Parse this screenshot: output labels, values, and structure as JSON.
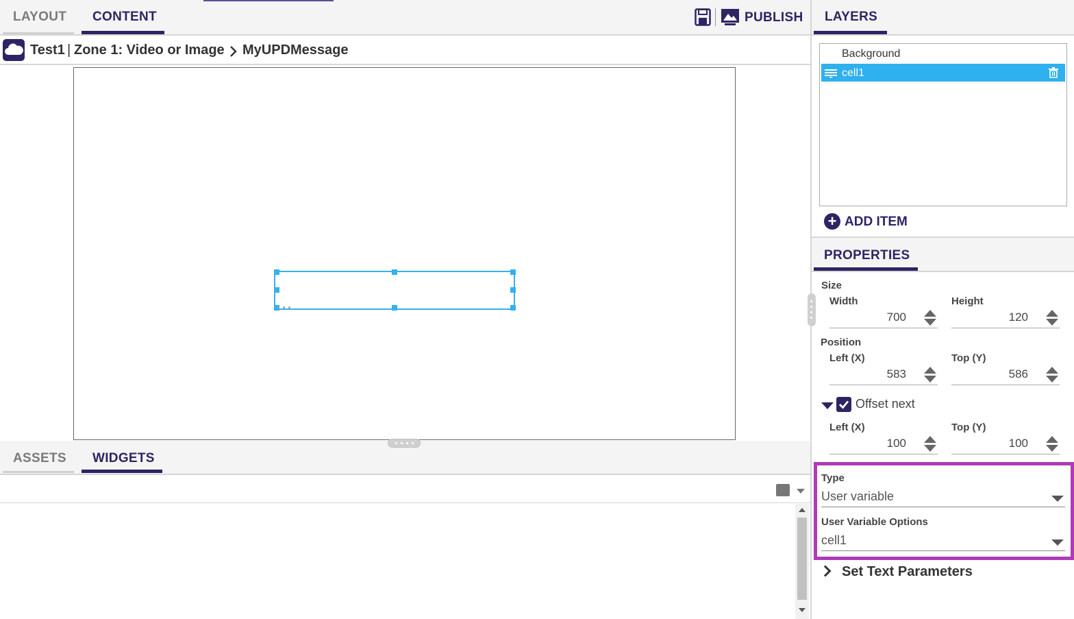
{
  "editor": {
    "tabs": [
      "LAYOUT",
      "CONTENT"
    ],
    "active_tab": "CONTENT",
    "publish_label": "PUBLISH",
    "breadcrumb": {
      "project": "Test1",
      "separator": "|",
      "zone": "Zone 1: Video or Image",
      "item": "MyUPDMessage"
    },
    "canvas_placeholder": "..."
  },
  "bottom_panel": {
    "tabs": [
      "ASSETS",
      "WIDGETS"
    ],
    "active_tab": "WIDGETS"
  },
  "layers": {
    "tab_label": "LAYERS",
    "items": [
      {
        "label": "Background",
        "selected": false
      },
      {
        "label": "cell1",
        "selected": true
      }
    ],
    "add_item_label": "ADD ITEM"
  },
  "properties": {
    "tab_label": "PROPERTIES",
    "size": {
      "label": "Size",
      "width_label": "Width",
      "width": "700",
      "height_label": "Height",
      "height": "120"
    },
    "position": {
      "label": "Position",
      "left_label": "Left (X)",
      "left": "583",
      "top_label": "Top (Y)",
      "top": "586"
    },
    "offset": {
      "label": "Offset next",
      "checked": true,
      "left_label": "Left (X)",
      "left": "100",
      "top_label": "Top (Y)",
      "top": "100"
    },
    "type": {
      "label": "Type",
      "value": "User variable"
    },
    "user_variable": {
      "label": "User Variable Options",
      "value": "cell1"
    },
    "text_params_label": "Set Text Parameters"
  },
  "colors": {
    "brand": "#2d2464",
    "selection": "#35b0ee",
    "highlight": "#b03ab8"
  }
}
